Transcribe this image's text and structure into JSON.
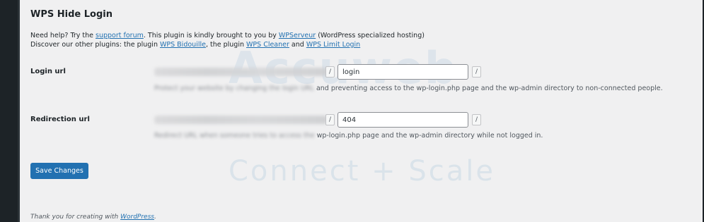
{
  "page": {
    "title": "WPS Hide Login",
    "help": {
      "prefix": "Need help? Try the ",
      "support_link": "support forum",
      "middle": ". This plugin is kindly brought to you by ",
      "author_link": "WPServeur",
      "suffix": " (WordPress specialized hosting)"
    },
    "discover": {
      "prefix": "Discover our other plugins: the plugin ",
      "plugin1": "WPS Bidouille",
      "sep1": ", the plugin ",
      "plugin2": "WPS Cleaner",
      "sep2": " and ",
      "plugin3": "WPS Limit Login"
    }
  },
  "login_url": {
    "label": "Login url",
    "slash_left": "/",
    "value": "login",
    "slash_right": "/",
    "description_blurred": "Protect your website by changing the login URL",
    "description": " and preventing access to the wp-login.php page and the wp-admin directory to non-connected people."
  },
  "redirection_url": {
    "label": "Redirection url",
    "slash_left": "/",
    "value": "404",
    "slash_right": "/",
    "description_blurred": "Redirect URL when someone tries to access the",
    "description": " wp-login.php page and the wp-admin directory while not logged in."
  },
  "actions": {
    "save_label": "Save Changes"
  },
  "footer": {
    "prefix": "Thank you for creating with ",
    "link": "WordPress",
    "suffix": "."
  },
  "watermark": {
    "top": "Accuweb",
    "bottom": "Connect + Scale"
  }
}
